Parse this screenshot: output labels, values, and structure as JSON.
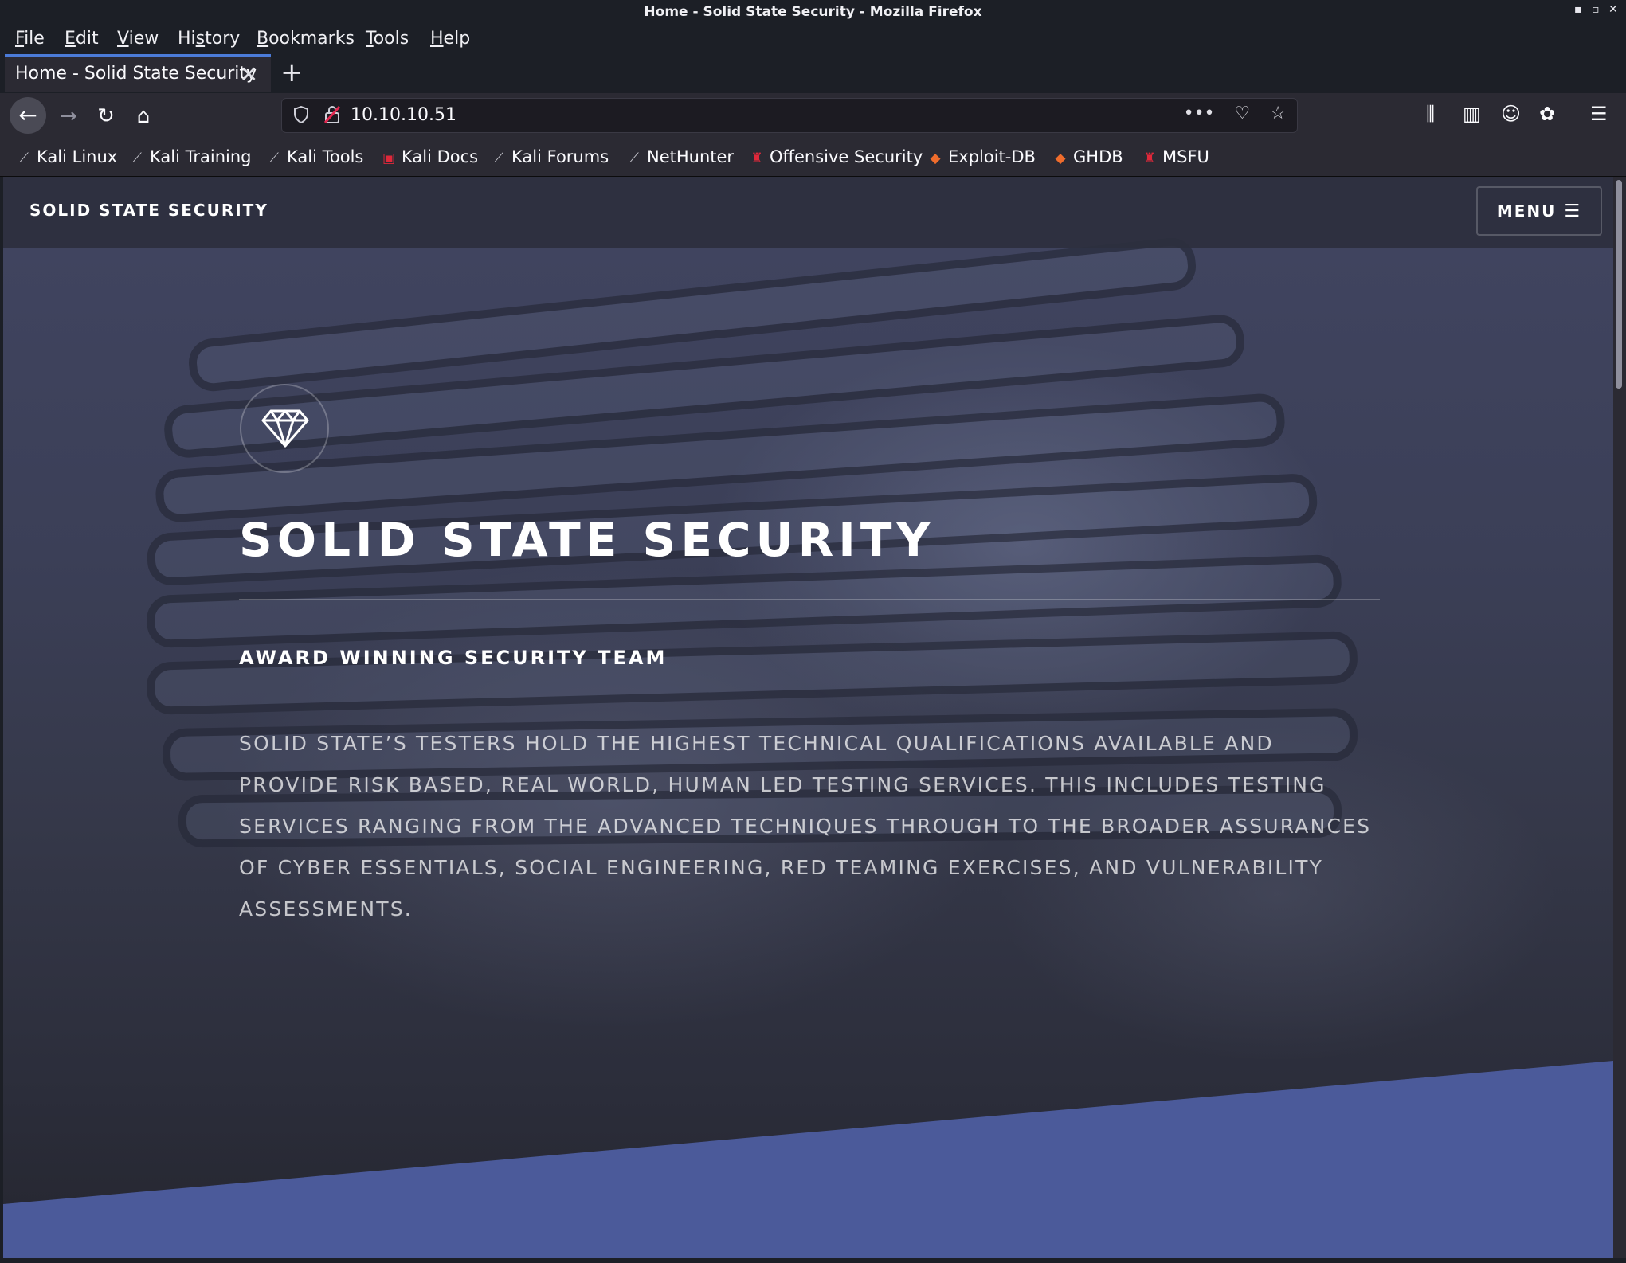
{
  "window": {
    "title": "Home - Solid State Security - Mozilla Firefox",
    "controls": {
      "minimize": "▪",
      "maximize": "▫",
      "close": "✕"
    }
  },
  "menubar": {
    "items": [
      {
        "label": "File",
        "accel": "F"
      },
      {
        "label": "Edit",
        "accel": "E"
      },
      {
        "label": "View",
        "accel": "V"
      },
      {
        "label": "History",
        "accel": "s"
      },
      {
        "label": "Bookmarks",
        "accel": "B"
      },
      {
        "label": "Tools",
        "accel": "T"
      },
      {
        "label": "Help",
        "accel": "H"
      }
    ]
  },
  "tabs": {
    "active": {
      "label": "Home - Solid State Security",
      "close": "✕"
    },
    "new_tab": "+"
  },
  "toolbar": {
    "back": "←",
    "forward": "→",
    "reload": "↻",
    "home": "⌂",
    "url": "10.10.10.51",
    "page_actions": {
      "more": "•••",
      "pocket": "♡",
      "bookmark_star": "☆"
    },
    "right_icons": {
      "library": "⫼",
      "sidebar": "▥",
      "account": "☺",
      "extensions": "✿",
      "menu": "☰"
    }
  },
  "bookmarks": [
    {
      "label": "Kali Linux",
      "icon": "kali-dragon-icon"
    },
    {
      "label": "Kali Training",
      "icon": "kali-dragon-icon"
    },
    {
      "label": "Kali Tools",
      "icon": "kali-dragon-icon"
    },
    {
      "label": "Kali Docs",
      "icon": "kali-docs-icon"
    },
    {
      "label": "Kali Forums",
      "icon": "kali-dragon-icon"
    },
    {
      "label": "NetHunter",
      "icon": "kali-dragon-icon"
    },
    {
      "label": "Offensive Security",
      "icon": "offsec-icon"
    },
    {
      "label": "Exploit-DB",
      "icon": "exploitdb-icon"
    },
    {
      "label": "GHDB",
      "icon": "exploitdb-icon"
    },
    {
      "label": "MSFU",
      "icon": "offsec-icon"
    }
  ],
  "site": {
    "brand": "SOLID STATE SECURITY",
    "menu_button": "MENU",
    "hero": {
      "title": "SOLID STATE SECURITY",
      "subtitle": "AWARD WINNING SECURITY TEAM",
      "body": "Solid State’s testers hold the highest technical qualifications available and provide risk based, real world, human led testing services. This includes testing services ranging from the advanced techniques through to the broader assurances of Cyber Essentials, social engineering, red teaming exercises, and vulnerability assessments."
    },
    "accent_color": "#4b5a9a",
    "logo_icon": "diamond-icon"
  },
  "colors": {
    "chrome_dark": "#1c1f26",
    "toolbar": "#2b2a33",
    "tab_accent": "#4b7bd8"
  }
}
